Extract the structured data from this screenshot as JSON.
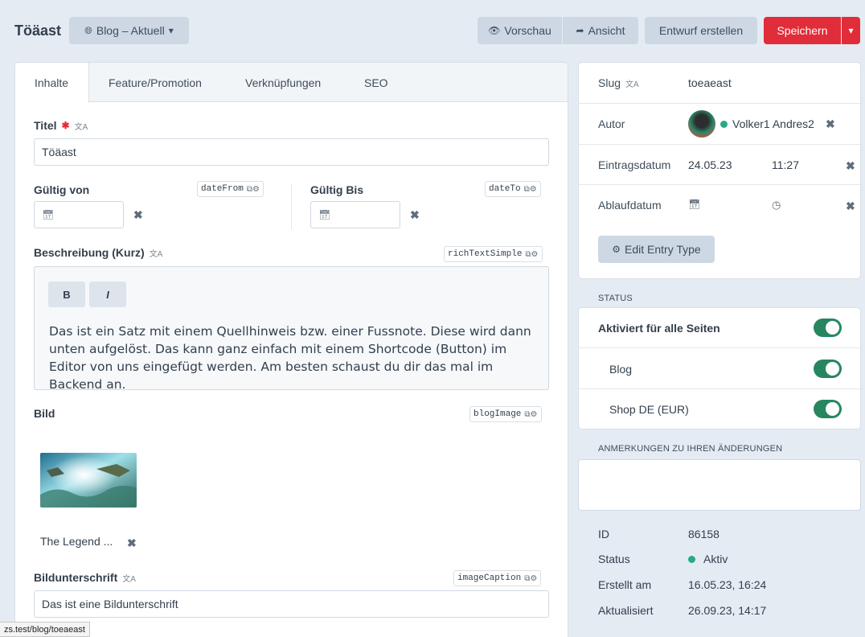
{
  "header": {
    "title": "Töäast",
    "site_select": "Blog – Aktuell",
    "preview": "Vorschau",
    "view": "Ansicht",
    "draft": "Entwurf erstellen",
    "save": "Speichern"
  },
  "tabs": [
    "Inhalte",
    "Feature/Promotion",
    "Verknüpfungen",
    "SEO"
  ],
  "fields": {
    "title": {
      "label": "Titel",
      "value": "Töäast"
    },
    "date_from": {
      "label": "Gültig von",
      "handle": "dateFrom"
    },
    "date_to": {
      "label": "Gültig Bis",
      "handle": "dateTo"
    },
    "description": {
      "label": "Beschreibung (Kurz)",
      "handle": "richTextSimple",
      "bold": "B",
      "italic": "I",
      "text": "Das ist ein Satz mit einem Quellhinweis bzw. einer Fussnote. Diese wird dann unten aufgelöst. Das kann ganz einfach mit einem Shortcode (Button) im Editor von uns eingefügt werden. Am besten schaust du dir das mal im Backend an."
    },
    "image": {
      "label": "Bild",
      "handle": "blogImage",
      "filename": "The Legend ..."
    },
    "caption": {
      "label": "Bildunterschrift",
      "handle": "imageCaption",
      "value": "Das ist eine Bildunterschrift"
    }
  },
  "tooltip_url": "zs.test/blog/toeaeast",
  "meta": {
    "slug_label": "Slug",
    "slug_value": "toeaeast",
    "author_label": "Autor",
    "author_name": "Volker1 Andres2",
    "entry_date_label": "Eintragsdatum",
    "entry_date": "24.05.23",
    "entry_time": "11:27",
    "expiry_label": "Ablaufdatum",
    "edit_entry_type": "Edit Entry Type"
  },
  "status": {
    "heading": "STATUS",
    "all_sites": "Aktiviert für alle Seiten",
    "sites": [
      "Blog",
      "Shop DE (EUR)"
    ]
  },
  "notes": {
    "heading": "ANMERKUNGEN ZU IHREN ÄNDERUNGEN"
  },
  "info": {
    "id_label": "ID",
    "id_value": "86158",
    "status_label": "Status",
    "status_value": "Aktiv",
    "created_label": "Erstellt am",
    "created_value": "16.05.23, 16:24",
    "updated_label": "Aktualisiert",
    "updated_value": "26.09.23, 14:17"
  },
  "colors": {
    "accent": "#e12d39",
    "toggle_on": "#27865f",
    "status_active": "#27ab83"
  }
}
